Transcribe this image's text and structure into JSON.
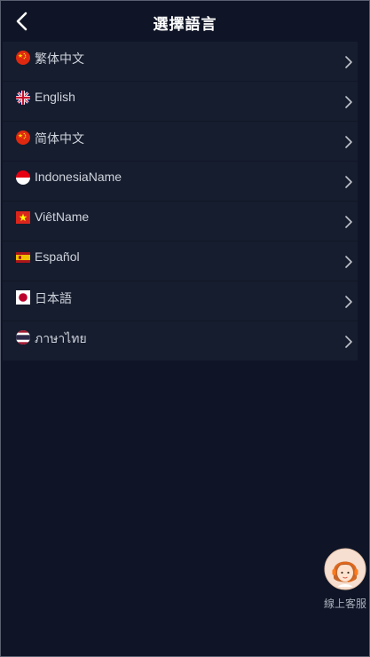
{
  "header": {
    "title": "選擇語言"
  },
  "languages": [
    {
      "label": "繁体中文",
      "flag": "china-flag-icon"
    },
    {
      "label": "English",
      "flag": "uk-flag-icon"
    },
    {
      "label": "简体中文",
      "flag": "china-flag-icon"
    },
    {
      "label": "IndonesiaName",
      "flag": "indonesia-flag-icon"
    },
    {
      "label": "ViêtName",
      "flag": "vietnam-flag-icon"
    },
    {
      "label": "Español",
      "flag": "spain-flag-icon"
    },
    {
      "label": "日本語",
      "flag": "japan-flag-icon"
    },
    {
      "label": "ภาษาไทย",
      "flag": "thailand-flag-icon"
    }
  ],
  "support": {
    "label": "線上客服"
  },
  "colors": {
    "background": "#0f1526",
    "list_background": "#161d2e",
    "text": "#cfd3dc"
  }
}
